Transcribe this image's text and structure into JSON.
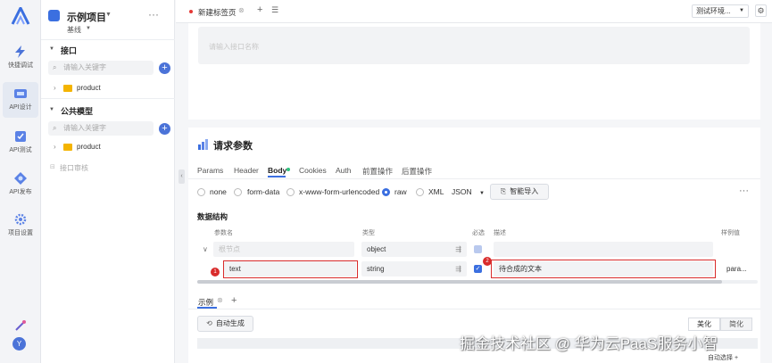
{
  "rail": {
    "items": [
      {
        "label": "快捷调试",
        "icon": "lightning-icon"
      },
      {
        "label": "API设计",
        "icon": "api-design-icon"
      },
      {
        "label": "API测试",
        "icon": "api-test-icon"
      },
      {
        "label": "API发布",
        "icon": "api-publish-icon"
      },
      {
        "label": "项目设置",
        "icon": "settings-icon"
      }
    ],
    "avatar": "Y"
  },
  "project": {
    "name": "示例项目",
    "branch": "基线",
    "more": "···"
  },
  "tree": {
    "interfaces": {
      "title": "接口",
      "search_placeholder": "请输入关键字",
      "folder": "product"
    },
    "models": {
      "title": "公共模型",
      "search_placeholder": "请输入关键字",
      "folder": "product"
    },
    "review": "接口审核"
  },
  "tabs": {
    "active_tab": "新建标签页",
    "env": "测试环境..."
  },
  "url_placeholder": "请输入接口名称",
  "params": {
    "title": "请求参数",
    "subtabs": [
      "Params",
      "Header",
      "Body",
      "Cookies",
      "Auth",
      "前置操作",
      "后置操作"
    ],
    "active_subtab": "Body",
    "body_types": [
      "none",
      "form-data",
      "x-www-form-urlencoded",
      "raw",
      "XML"
    ],
    "selected_body_type": "raw",
    "format": "JSON",
    "smart_import": "智能导入",
    "more": "···",
    "section_title": "数据结构",
    "columns": [
      "参数名",
      "类型",
      "必选",
      "描述",
      "样例值"
    ],
    "rows": [
      {
        "name_placeholder": "根节点",
        "type": "object",
        "required": true
      },
      {
        "name": "text",
        "type": "string",
        "required": true,
        "desc": "待合成的文本",
        "example": "para..."
      }
    ],
    "annotations": [
      "1",
      "2"
    ]
  },
  "example": {
    "tab": "示例",
    "add": "+",
    "auto_generate": "自动生成",
    "beautify": "美化",
    "simplify": "简化",
    "auto_select": "自动选择"
  },
  "watermark": "掘金技术社区 @ 华为云PaaS服务小智",
  "colors": {
    "accent": "#3b6fe0",
    "annotation_red": "#d92b2b",
    "tab_dot_red": "#e53935",
    "body_dot_green": "#2ec27e"
  }
}
